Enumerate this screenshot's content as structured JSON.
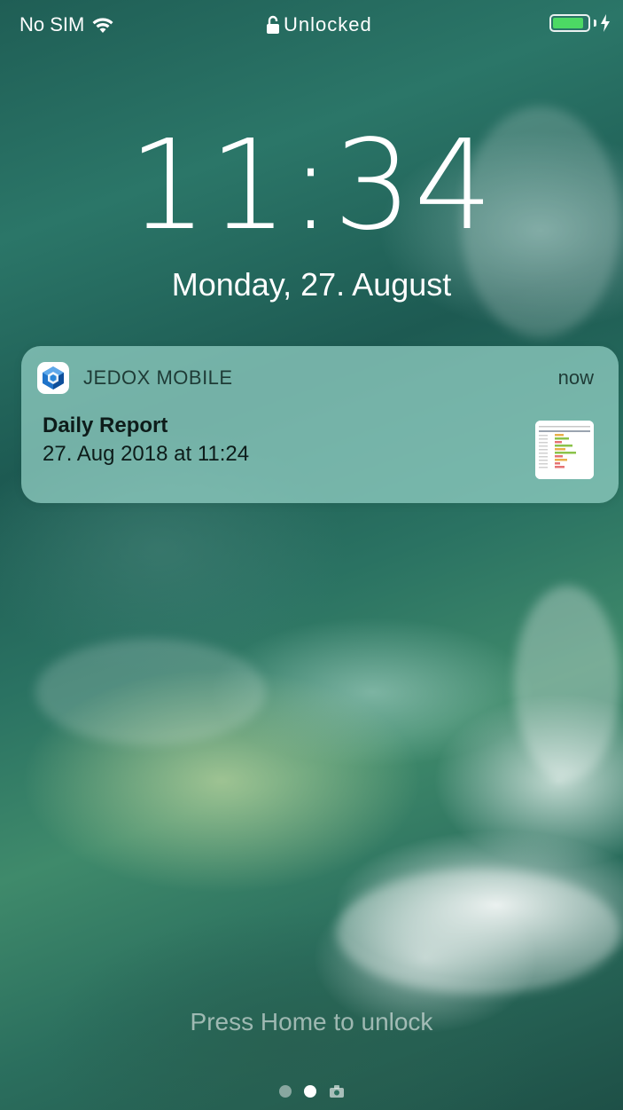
{
  "status_bar": {
    "carrier": "No SIM",
    "lock_status": "Unlocked",
    "battery_level": 0.9,
    "battery_color": "#4cd964"
  },
  "lock_screen": {
    "time": "11:34",
    "date": "Monday, 27. August"
  },
  "notification": {
    "app_icon": "jedox-cube-icon",
    "app_name": "JEDOX MOBILE",
    "time": "now",
    "title": "Daily Report",
    "body": "27. Aug 2018 at 11:24",
    "thumbnail": "report-thumbnail"
  },
  "footer": {
    "hint": "Press Home to unlock",
    "page_dots": [
      "widgets",
      "lock-screen",
      "camera"
    ],
    "active_page": "lock-screen"
  }
}
